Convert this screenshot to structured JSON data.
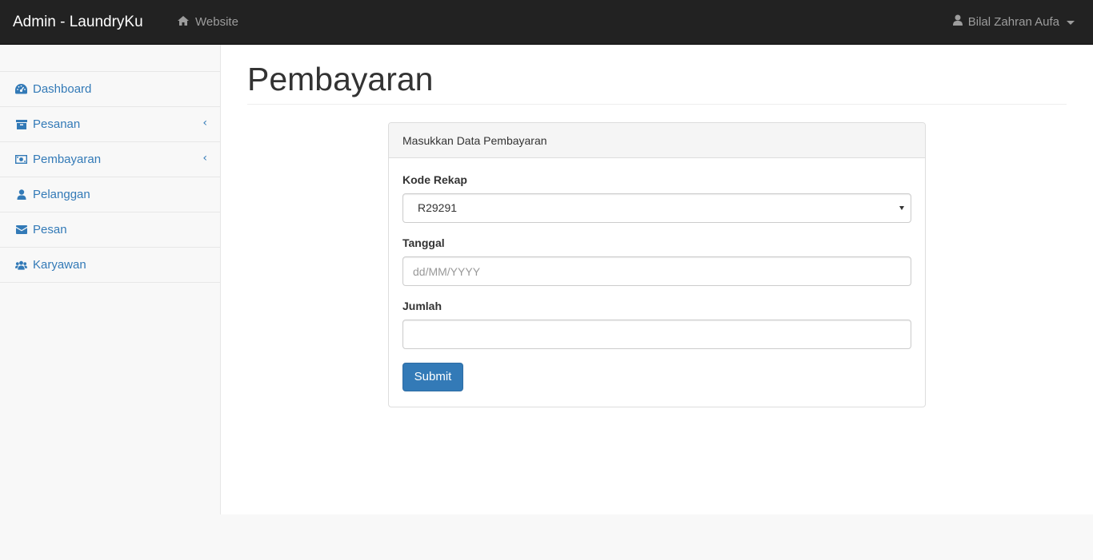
{
  "navbar": {
    "brand": "Admin - LaundryKu",
    "website_label": "Website",
    "user_name": "Bilal Zahran Aufa"
  },
  "sidebar": {
    "items": [
      {
        "label": "Dashboard",
        "icon": "dashboard-icon",
        "has_submenu": false
      },
      {
        "label": "Pesanan",
        "icon": "archive-icon",
        "has_submenu": true
      },
      {
        "label": "Pembayaran",
        "icon": "money-icon",
        "has_submenu": true
      },
      {
        "label": "Pelanggan",
        "icon": "user-icon",
        "has_submenu": false
      },
      {
        "label": "Pesan",
        "icon": "envelope-icon",
        "has_submenu": false
      },
      {
        "label": "Karyawan",
        "icon": "users-icon",
        "has_submenu": false
      }
    ]
  },
  "page": {
    "title": "Pembayaran"
  },
  "form": {
    "panel_title": "Masukkan Data Pembayaran",
    "kode_rekap_label": "Kode Rekap",
    "kode_rekap_value": "R29291",
    "tanggal_label": "Tanggal",
    "tanggal_placeholder": "dd/MM/YYYY",
    "jumlah_label": "Jumlah",
    "jumlah_value": "",
    "submit_label": "Submit"
  },
  "colors": {
    "navbar_bg": "#222222",
    "link": "#337ab7",
    "primary_button": "#337ab7"
  }
}
